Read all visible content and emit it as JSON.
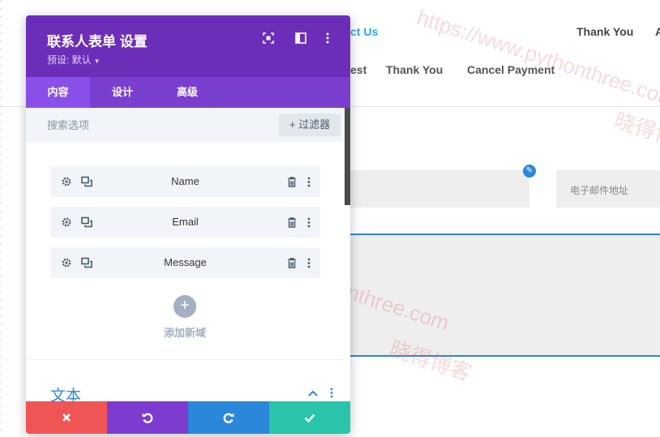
{
  "background_page": {
    "nav_top": [
      "ct Us",
      "Thank You",
      "A"
    ],
    "nav_row": [
      "est",
      "Thank You",
      "Cancel Payment"
    ],
    "email_placeholder": "电子邮件地址"
  },
  "watermarks": [
    "https://www.pythonthree.com",
    "晓得博客",
    "https://www.pythonthree.com",
    "晓得博客"
  ],
  "panel": {
    "title": "联系人表单 设置",
    "preset": "预设: 默认",
    "tabs": [
      {
        "label": "内容",
        "active": true
      },
      {
        "label": "设计",
        "active": false
      },
      {
        "label": "高级",
        "active": false
      }
    ],
    "search": {
      "placeholder": "搜索选项",
      "value": ""
    },
    "filter_label": "过滤器",
    "fields": [
      {
        "label": "Name"
      },
      {
        "label": "Email"
      },
      {
        "label": "Message"
      }
    ],
    "add_label": "添加新域",
    "section_title": "文本",
    "icons": {
      "header": [
        "expand-icon",
        "split-view-icon",
        "more-icon"
      ],
      "field": [
        "gear-icon",
        "duplicate-icon",
        "trash-icon",
        "more-icon"
      ]
    }
  },
  "colors": {
    "header": "#6c2eb9",
    "tabs": "#7b3fd0",
    "cancel": "#ef5555",
    "undo": "#7e3bd0",
    "redo": "#2b87da",
    "save": "#29c4a9",
    "accent": "#2b87da"
  }
}
